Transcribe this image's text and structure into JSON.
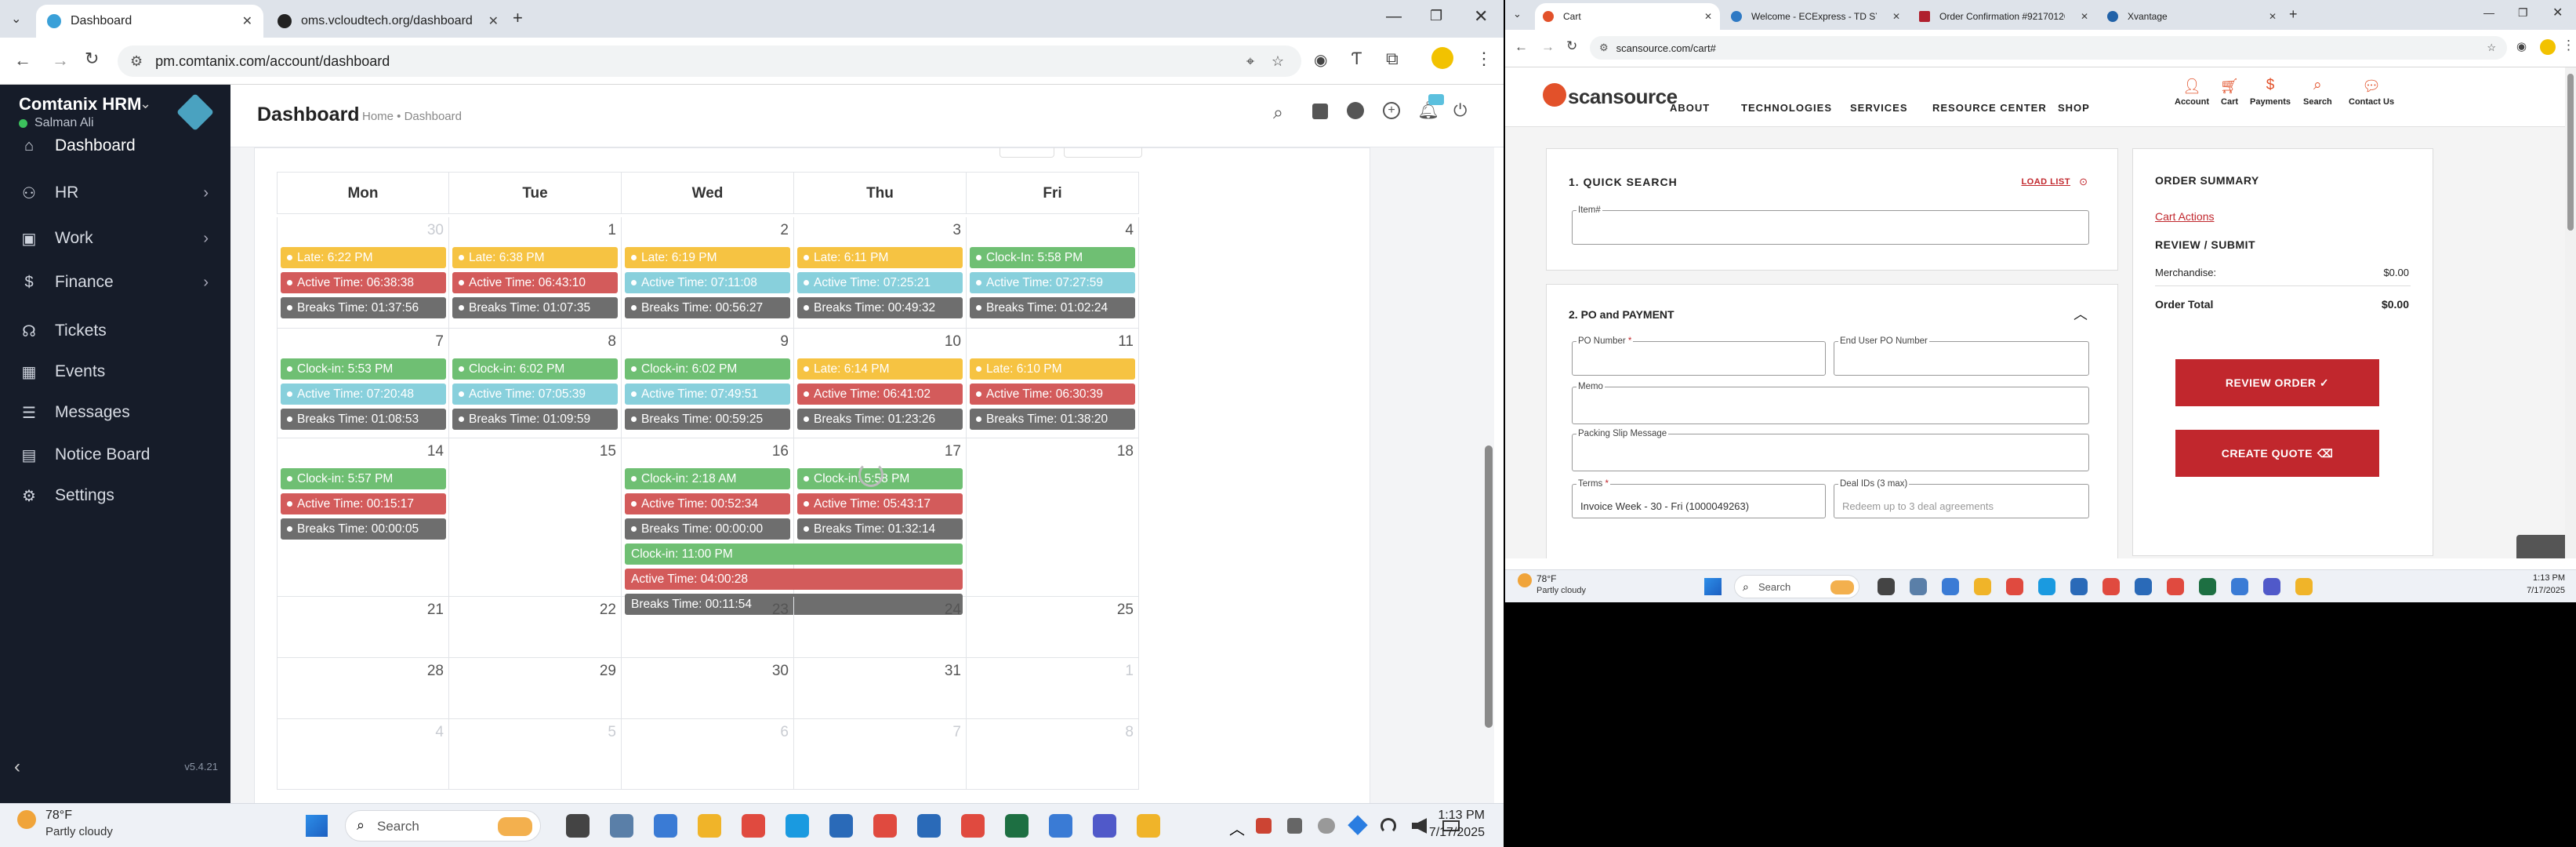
{
  "left_browser": {
    "tabs": [
      {
        "title": "Dashboard"
      },
      {
        "title": "oms.vcloudtech.org/dashboard"
      }
    ],
    "url": "pm.comtanix.com/account/dashboard"
  },
  "hrm": {
    "brand": "Comtanix HRM",
    "user": "Salman Ali",
    "nav": [
      {
        "label": "Dashboard",
        "icon": "home-icon"
      },
      {
        "label": "HR",
        "icon": "users-icon"
      },
      {
        "label": "Work",
        "icon": "briefcase-icon"
      },
      {
        "label": "Finance",
        "icon": "dollar-icon"
      },
      {
        "label": "Tickets",
        "icon": "headset-icon"
      },
      {
        "label": "Events",
        "icon": "calendar-icon"
      },
      {
        "label": "Messages",
        "icon": "chat-icon"
      },
      {
        "label": "Notice Board",
        "icon": "clipboard-icon"
      },
      {
        "label": "Settings",
        "icon": "gear-icon"
      }
    ],
    "version": "v5.4.21",
    "page_title": "Dashboard",
    "breadcrumb": "Home • Dashboard",
    "calendar": {
      "weekdays": [
        "Mon",
        "Tue",
        "Wed",
        "Thu",
        "Fri"
      ],
      "weeks": [
        {
          "days": [
            {
              "num": "30",
              "dim": true,
              "events": [
                {
                  "t": "late",
                  "text": "Late: 6:22 PM"
                },
                {
                  "t": "act",
                  "text": "Active Time: 06:38:38"
                },
                {
                  "t": "brk",
                  "text": "Breaks Time: 01:37:56"
                }
              ]
            },
            {
              "num": "1",
              "events": [
                {
                  "t": "late",
                  "text": "Late: 6:38 PM"
                },
                {
                  "t": "act",
                  "text": "Active Time: 06:43:10"
                },
                {
                  "t": "brk",
                  "text": "Breaks Time: 01:07:35"
                }
              ]
            },
            {
              "num": "2",
              "events": [
                {
                  "t": "late",
                  "text": "Late: 6:19 PM"
                },
                {
                  "t": "atc",
                  "text": "Active Time: 07:11:08"
                },
                {
                  "t": "brk",
                  "text": "Breaks Time: 00:56:27"
                }
              ]
            },
            {
              "num": "3",
              "events": [
                {
                  "t": "late",
                  "text": "Late: 6:11 PM"
                },
                {
                  "t": "atc",
                  "text": "Active Time: 07:25:21"
                },
                {
                  "t": "brk",
                  "text": "Breaks Time: 00:49:32"
                }
              ]
            },
            {
              "num": "4",
              "events": [
                {
                  "t": "clk",
                  "text": "Clock-In: 5:58 PM"
                },
                {
                  "t": "atc",
                  "text": "Active Time: 07:27:59"
                },
                {
                  "t": "brk",
                  "text": "Breaks Time: 01:02:24"
                }
              ]
            }
          ]
        },
        {
          "days": [
            {
              "num": "7",
              "events": [
                {
                  "t": "clk",
                  "text": "Clock-in: 5:53 PM"
                },
                {
                  "t": "atc",
                  "text": "Active Time: 07:20:48"
                },
                {
                  "t": "brk",
                  "text": "Breaks Time: 01:08:53"
                }
              ]
            },
            {
              "num": "8",
              "events": [
                {
                  "t": "clk",
                  "text": "Clock-in: 6:02 PM"
                },
                {
                  "t": "atc",
                  "text": "Active Time: 07:05:39"
                },
                {
                  "t": "brk",
                  "text": "Breaks Time: 01:09:59"
                }
              ]
            },
            {
              "num": "9",
              "events": [
                {
                  "t": "clk",
                  "text": "Clock-in: 6:02 PM"
                },
                {
                  "t": "atc",
                  "text": "Active Time: 07:49:51"
                },
                {
                  "t": "brk",
                  "text": "Breaks Time: 00:59:25"
                }
              ]
            },
            {
              "num": "10",
              "events": [
                {
                  "t": "late",
                  "text": "Late: 6:14 PM"
                },
                {
                  "t": "act",
                  "text": "Active Time: 06:41:02"
                },
                {
                  "t": "brk",
                  "text": "Breaks Time: 01:23:26"
                }
              ]
            },
            {
              "num": "11",
              "events": [
                {
                  "t": "late",
                  "text": "Late: 6:10 PM"
                },
                {
                  "t": "act",
                  "text": "Active Time: 06:30:39"
                },
                {
                  "t": "brk",
                  "text": "Breaks Time: 01:38:20"
                }
              ]
            }
          ]
        },
        {
          "days": [
            {
              "num": "14",
              "events": [
                {
                  "t": "clk",
                  "text": "Clock-in: 5:57 PM"
                },
                {
                  "t": "act",
                  "text": "Active Time: 00:15:17"
                },
                {
                  "t": "brk",
                  "text": "Breaks Time: 00:00:05"
                }
              ]
            },
            {
              "num": "15",
              "events": []
            },
            {
              "num": "16",
              "events": [
                {
                  "t": "clk",
                  "text": "Clock-in: 2:18 AM"
                },
                {
                  "t": "act",
                  "text": "Active Time: 00:52:34"
                },
                {
                  "t": "brk",
                  "text": "Breaks Time: 00:00:00"
                }
              ]
            },
            {
              "num": "17",
              "events": [
                {
                  "t": "clk",
                  "text": "Clock-in: 5:58 PM"
                },
                {
                  "t": "act",
                  "text": "Active Time: 05:43:17"
                },
                {
                  "t": "brk",
                  "text": "Breaks Time: 01:32:14"
                }
              ]
            },
            {
              "num": "18",
              "events": []
            }
          ],
          "span_events": [
            {
              "t": "clk",
              "text": "Clock-in: 11:00 PM"
            },
            {
              "t": "act",
              "text": "Active Time: 04:00:28"
            },
            {
              "t": "brk",
              "text": "Breaks Time: 00:11:54"
            }
          ]
        },
        {
          "days": [
            {
              "num": "21",
              "events": []
            },
            {
              "num": "22",
              "events": []
            },
            {
              "num": "23",
              "events": []
            },
            {
              "num": "24",
              "events": []
            },
            {
              "num": "25",
              "events": []
            }
          ]
        },
        {
          "days": [
            {
              "num": "28",
              "events": []
            },
            {
              "num": "29",
              "events": []
            },
            {
              "num": "30",
              "events": []
            },
            {
              "num": "31",
              "events": []
            },
            {
              "num": "1",
              "dim": true,
              "events": []
            }
          ]
        },
        {
          "days": [
            {
              "num": "4",
              "dim": true,
              "events": []
            },
            {
              "num": "5",
              "dim": true,
              "events": []
            },
            {
              "num": "6",
              "dim": true,
              "events": []
            },
            {
              "num": "7",
              "dim": true,
              "events": []
            },
            {
              "num": "8",
              "dim": true,
              "events": []
            }
          ]
        }
      ]
    }
  },
  "left_taskbar": {
    "weather_temp": "78°F",
    "weather_desc": "Partly cloudy",
    "search_label": "Search",
    "time": "1:13 PM",
    "date": "7/17/2025"
  },
  "right_browser": {
    "tabs": [
      {
        "title": "Cart"
      },
      {
        "title": "Welcome - ECExpress - TD SYNNEX"
      },
      {
        "title": "Order Confirmation #92170126"
      },
      {
        "title": "Xvantage"
      }
    ],
    "url": "scansource.com/cart#"
  },
  "scansource": {
    "logo": "scansource",
    "nav": [
      "ABOUT",
      "TECHNOLOGIES",
      "SERVICES",
      "RESOURCE CENTER",
      "SHOP"
    ],
    "utility": [
      "Account",
      "Cart",
      "Payments",
      "Search",
      "Contact Us"
    ],
    "quick_search": {
      "title": "1. QUICK SEARCH",
      "load_list": "LOAD LIST",
      "item_label": "Item#"
    },
    "po": {
      "title": "2. PO and PAYMENT",
      "po_number": "PO Number",
      "end_user_po": "End User PO Number",
      "memo": "Memo",
      "packing_slip": "Packing Slip Message",
      "terms_label": "Terms",
      "terms_value": "Invoice Week - 30 - Fri (1000049263)",
      "deal_label": "Deal IDs (3 max)",
      "deal_placeholder": "Redeem up to 3 deal agreements"
    },
    "summary": {
      "title": "ORDER SUMMARY",
      "cart_actions": "Cart Actions",
      "review_title": "REVIEW / SUBMIT",
      "merch_label": "Merchandise:",
      "merch_value": "$0.00",
      "total_label": "Order Total",
      "total_value": "$0.00",
      "review_btn": "REVIEW ORDER ✓",
      "quote_btn": "CREATE QUOTE"
    }
  },
  "right_taskbar": {
    "weather_temp": "78°F",
    "weather_desc": "Partly cloudy",
    "search_label": "Search",
    "time": "1:13 PM",
    "date": "7/17/2025"
  }
}
